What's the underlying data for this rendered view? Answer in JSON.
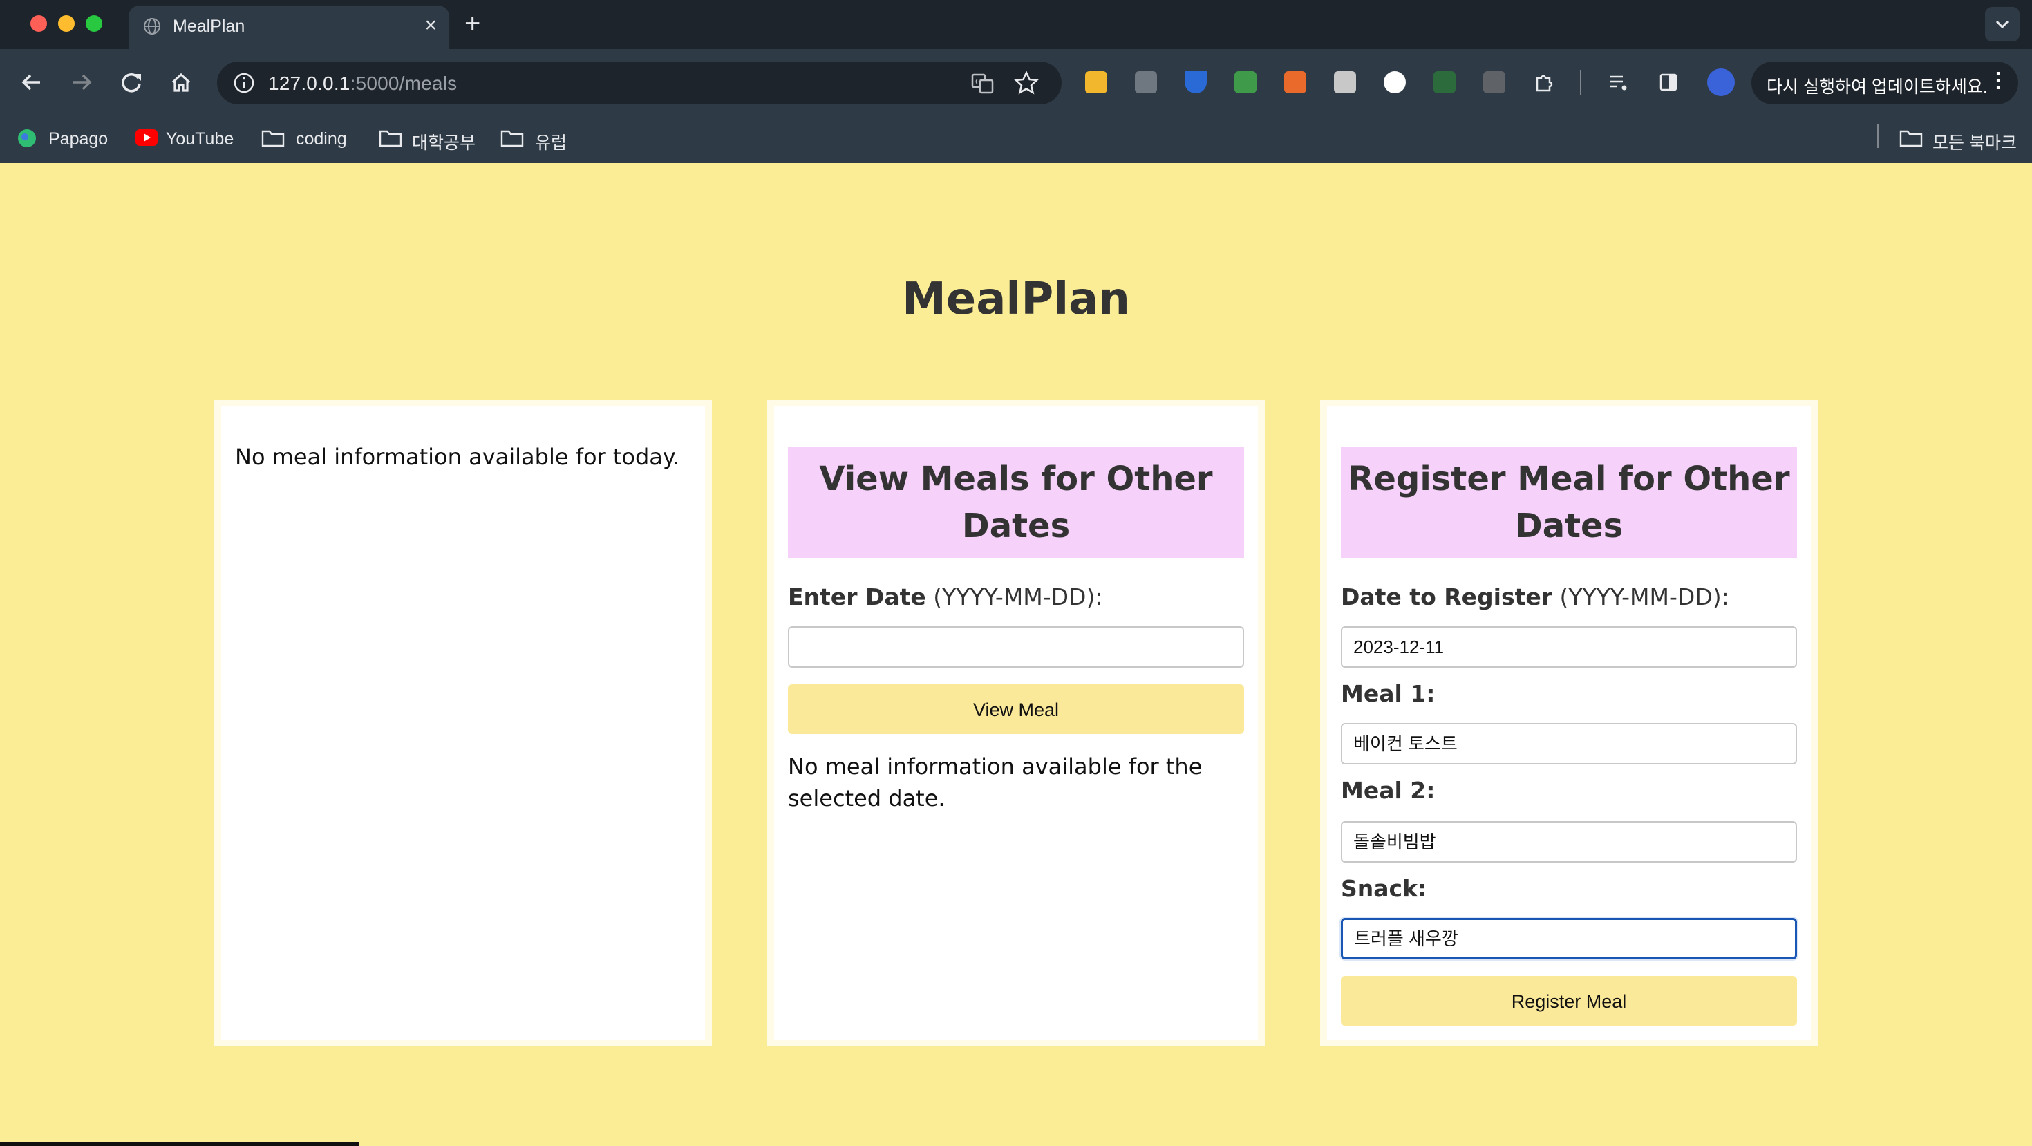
{
  "browser": {
    "tab_title": "MealPlan",
    "tab_close": "×",
    "new_tab": "+",
    "url_host": "127.0.0.1",
    "url_path": ":5000/meals",
    "update_text": "다시 실행하여 업데이트하세요.",
    "update_more": "⋮",
    "bookmarks": [
      {
        "label": "Papago",
        "icon": "papago-icon"
      },
      {
        "label": "YouTube",
        "icon": "youtube-icon"
      },
      {
        "label": "coding",
        "icon": "folder-icon"
      },
      {
        "label": "대학공부",
        "icon": "folder-icon"
      },
      {
        "label": "유럽",
        "icon": "folder-icon"
      }
    ],
    "all_bookmarks": "모든 북마크"
  },
  "page": {
    "title": "MealPlan",
    "today": {
      "message": "No meal information available for today."
    },
    "view": {
      "heading": "View Meals for Other Dates",
      "date_label_bold": "Enter Date",
      "date_label_plain": " (YYYY-MM-DD):",
      "date_value": "",
      "button": "View Meal",
      "result": "No meal information available for the selected date."
    },
    "register": {
      "heading": "Register Meal for Other Dates",
      "date_label_bold": "Date to Register",
      "date_label_plain": " (YYYY-MM-DD):",
      "date_value": "2023-12-11",
      "meal1_label": "Meal 1:",
      "meal1_value": "베이컨 토스트",
      "meal2_label": "Meal 2:",
      "meal2_value": "돌솥비빔밥",
      "snack_label": "Snack:",
      "snack_value": "트러플 새우깡",
      "button": "Register Meal"
    }
  },
  "colors": {
    "page_background": "#fbed96",
    "card_header": "#f6d1f9",
    "button": "#fbe99a",
    "chrome_dark": "#1e242b",
    "chrome_toolbar": "#2e3a45"
  }
}
